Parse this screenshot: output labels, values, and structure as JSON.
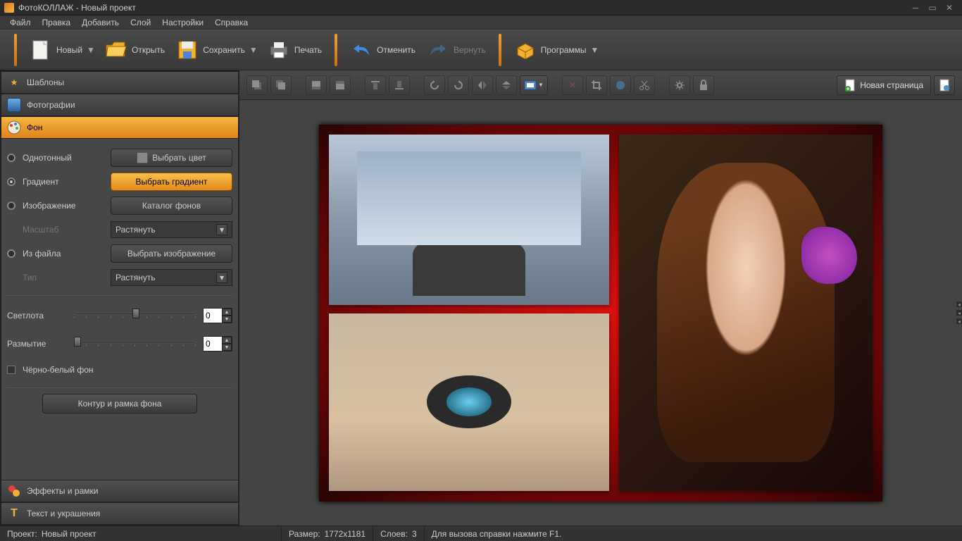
{
  "window": {
    "title": "ФотоКОЛЛАЖ - Новый проект"
  },
  "menu": {
    "file": "Файл",
    "edit": "Правка",
    "add": "Добавить",
    "layer": "Слой",
    "settings": "Настройки",
    "help": "Справка"
  },
  "toolbar": {
    "new": "Новый",
    "open": "Открыть",
    "save": "Сохранить",
    "print": "Печать",
    "undo": "Отменить",
    "redo": "Вернуть",
    "programs": "Программы"
  },
  "sidebar": {
    "tabs": {
      "templates": "Шаблоны",
      "photos": "Фотографии",
      "background": "Фон",
      "effects": "Эффекты и рамки",
      "text": "Текст и украшения"
    },
    "bg": {
      "solid": "Однотонный",
      "pick_color": "Выбрать цвет",
      "gradient": "Градиент",
      "pick_gradient": "Выбрать градиент",
      "image": "Изображение",
      "catalog": "Каталог фонов",
      "scale": "Масштаб",
      "stretch": "Растянуть",
      "from_file": "Из файла",
      "pick_image": "Выбрать изображение",
      "type": "Тип",
      "brightness": "Светлота",
      "brightness_val": "0",
      "blur": "Размытие",
      "blur_val": "0",
      "bw": "Чёрно-белый фон",
      "frame_btn": "Контур и рамка фона"
    }
  },
  "canvas_toolbar": {
    "new_page": "Новая страница"
  },
  "status": {
    "project_label": "Проект:",
    "project_value": "Новый проект",
    "size_label": "Размер:",
    "size_value": "1772x1181",
    "layers_label": "Слоев:",
    "layers_value": "3",
    "help": "Для вызова справки нажмите F1."
  }
}
